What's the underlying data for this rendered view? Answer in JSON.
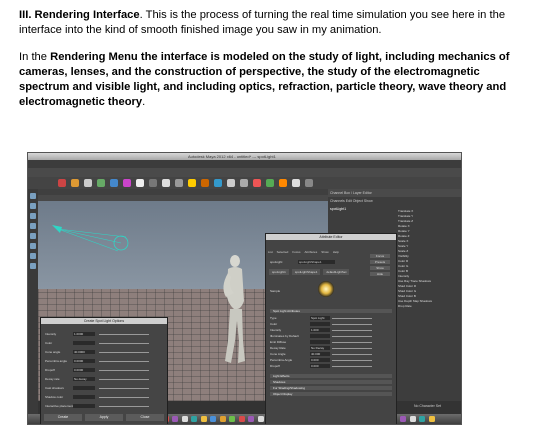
{
  "intro": {
    "heading": "III. Rendering Interface",
    "text": ".  This is the process of turning the real time simulation you see here in the interface into the kind of smooth finished image you saw in my animation."
  },
  "body": {
    "lead": "In the ",
    "bold": "Rendering Menu the interface is modeled on the study of light, including mechanics of cameras, lenses, and the construction of perspective, the study of the electromagnetic spectrum and visible light, and including optics, refraction, particle theory, wave theory and electromagnetic theory",
    "tail": "."
  },
  "screenshot": {
    "window_title": "Autodesk Maya 2012 x64 - untitled* --- spotLight1",
    "menus": [
      "Rendering",
      "File",
      "Edit",
      "Modify",
      "Create",
      "Display",
      "Window",
      "Assets",
      "Lighting/Shading",
      "Texturing",
      "Render",
      "Toon",
      "Stereo",
      "Paint Effects",
      "Fluid Effects",
      "Fur",
      "Hair",
      "nMesh",
      "Muscle",
      "Help"
    ],
    "shelf_tabs": [
      "General",
      "Curves",
      "Surfaces",
      "Polygons",
      "Subdivs",
      "Deformation",
      "Animation",
      "Dynamics",
      "Rendering",
      "PaintEffects",
      "Toon",
      "Muscle",
      "Fluids",
      "Fur",
      "Hair",
      "nCloth",
      "Custom"
    ],
    "active_shelf": "Rendering",
    "viewport_menus": [
      "View",
      "Shading",
      "Lighting",
      "Show",
      "Renderer",
      "Panels"
    ],
    "channel_box": {
      "header": "Channel Box / Layer Editor",
      "tabs": [
        "Channels",
        "Edit",
        "Object",
        "Show"
      ],
      "object": "spotLight1",
      "attributes": [
        "Translate X",
        "Translate Y",
        "Translate Z",
        "Rotate X",
        "Rotate Y",
        "Rotate Z",
        "Scale X",
        "Scale Y",
        "Scale Z",
        "Visibility",
        "Color R",
        "Color G",
        "Color B",
        "Intensity",
        "Use Ray Trace Shadows",
        "Shad Color R",
        "Shad Color G",
        "Shad Color B",
        "Use Depth Map Shadows",
        "Drop Rate"
      ]
    },
    "attribute_editor": {
      "title": "Attribute Editor",
      "menus": [
        "List",
        "Selected",
        "Focus",
        "Attributes",
        "Show",
        "Help"
      ],
      "tabs": [
        "spotLight1",
        "spotLightShape1",
        "defaultLightSet"
      ],
      "name_label": "spotLight:",
      "name_value": "spotLightShape1",
      "buttons": [
        "Focus",
        "Presets",
        "Show",
        "Hide"
      ],
      "sample_label": "Sample",
      "section": "Spot Light Attributes",
      "rows": [
        {
          "label": "Type",
          "value": "Spot Light"
        },
        {
          "label": "Color",
          "value": ""
        },
        {
          "label": "Intensity",
          "value": "1.000"
        },
        {
          "label": "Illuminates by Default",
          "value": ""
        },
        {
          "label": "Emit Diffuse",
          "value": ""
        },
        {
          "label": "Decay Rate",
          "value": "No Decay"
        },
        {
          "label": "Cone Angle",
          "value": "40.000"
        },
        {
          "label": "Penumbra Angle",
          "value": "0.000"
        },
        {
          "label": "Dropoff",
          "value": "0.000"
        }
      ],
      "collapsed_sections": [
        "Light Effects",
        "Shadows",
        "Fur Shading/Shadowing",
        "Object Display"
      ]
    },
    "spot_options": {
      "title": "Create Spot Light Options",
      "rows": [
        {
          "label": "Intensity",
          "value": "1.0000"
        },
        {
          "label": "Color",
          "value": ""
        },
        {
          "label": "Cone angle",
          "value": "40.0000"
        },
        {
          "label": "Penumbra angle",
          "value": "0.0000"
        },
        {
          "label": "Dropoff",
          "value": "0.0000"
        },
        {
          "label": "Decay rate",
          "value": "No decay"
        },
        {
          "label": "Cast shadows",
          "value": ""
        },
        {
          "label": "Shadow color",
          "value": ""
        },
        {
          "label": "Interactive placement",
          "value": ""
        }
      ],
      "buttons": [
        "Create",
        "Apply",
        "Close"
      ]
    },
    "timeline_label": "No Character Set"
  }
}
